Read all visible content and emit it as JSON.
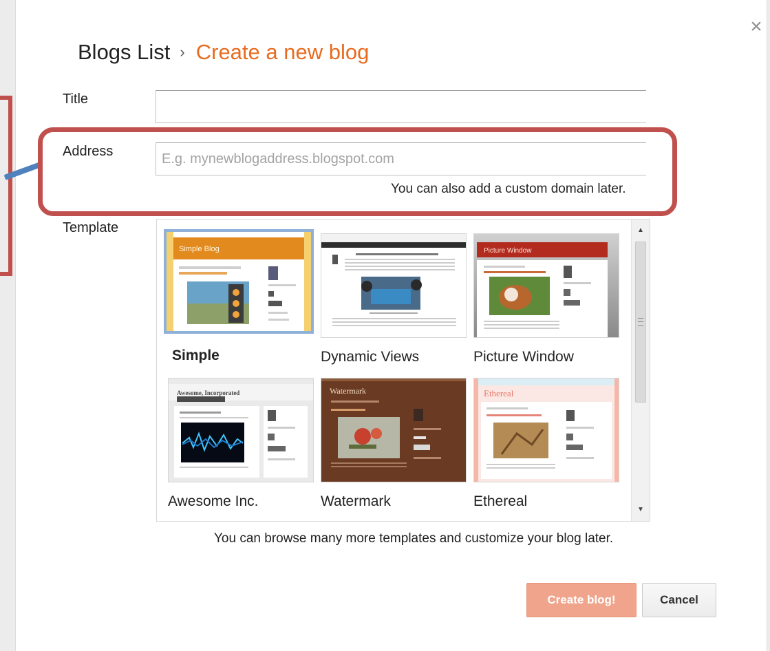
{
  "dialog": {
    "close_glyph": "×",
    "breadcrumb": {
      "root": "Blogs List",
      "separator": "›",
      "current": "Create a new blog"
    },
    "colors": {
      "accent": "#e86b1f",
      "annotation_box": "#c0504d",
      "annotation_connector": "#4f81bd",
      "selected_template_border": "#8fb0d8"
    }
  },
  "form": {
    "title": {
      "label": "Title",
      "value": ""
    },
    "address": {
      "label": "Address",
      "placeholder": "E.g. mynewblogaddress.blogspot.com",
      "value": "",
      "hint": "You can also add a custom domain later."
    },
    "template": {
      "label": "Template",
      "selected": "Simple",
      "items": [
        {
          "name": "Simple"
        },
        {
          "name": "Dynamic Views"
        },
        {
          "name": "Picture Window"
        },
        {
          "name": "Awesome Inc."
        },
        {
          "name": "Watermark"
        },
        {
          "name": "Ethereal"
        }
      ],
      "thumb_titles": {
        "simple": "Simple Blog",
        "picture_window": "Picture Window",
        "awesome": "Awesome, Incorporated",
        "watermark": "Watermark",
        "ethereal": "Ethereal"
      },
      "hint": "You can browse many more templates and customize your blog later."
    }
  },
  "actions": {
    "create_label": "Create blog!",
    "cancel_label": "Cancel"
  }
}
